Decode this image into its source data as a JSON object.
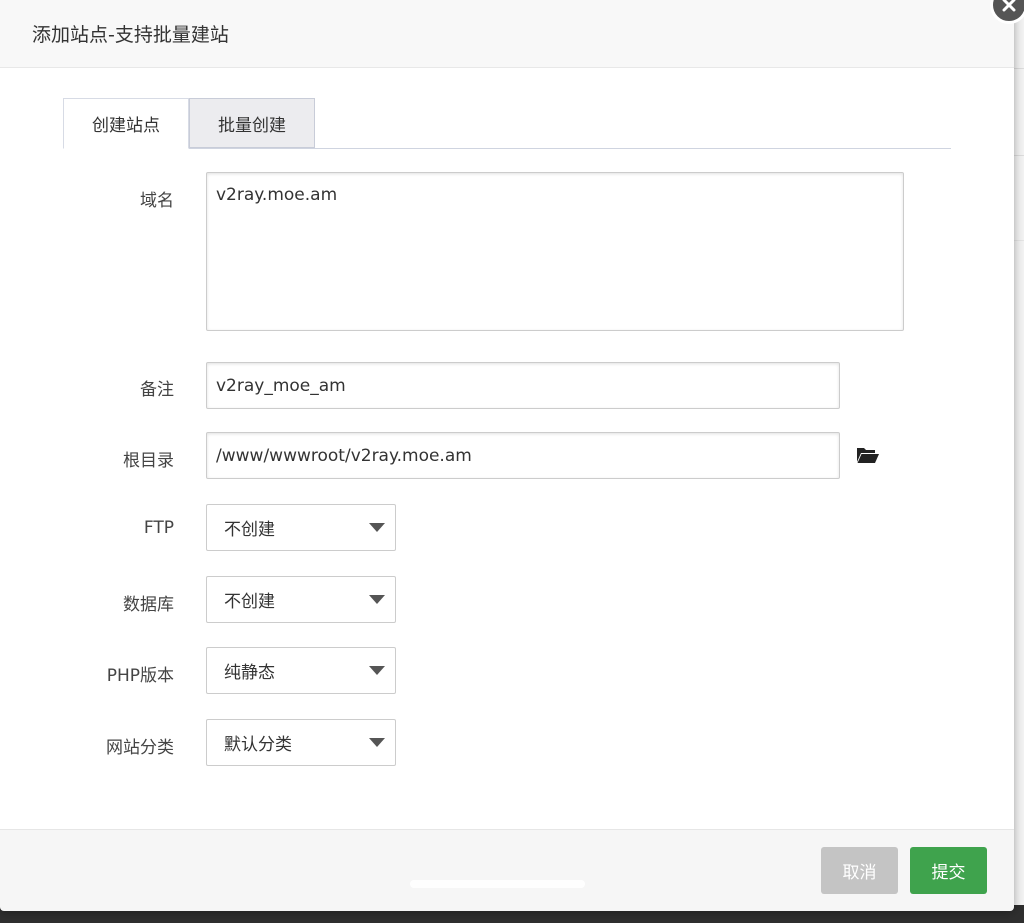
{
  "dialog": {
    "title": "添加站点-支持批量建站"
  },
  "tabs": [
    {
      "label": "创建站点",
      "active": true
    },
    {
      "label": "批量创建",
      "active": false
    }
  ],
  "form": {
    "domain": {
      "label": "域名",
      "value": "v2ray.moe.am"
    },
    "remark": {
      "label": "备注",
      "value": "v2ray_moe_am"
    },
    "root": {
      "label": "根目录",
      "value": "/www/wwwroot/v2ray.moe.am"
    },
    "ftp": {
      "label": "FTP",
      "selected": "不创建"
    },
    "database": {
      "label": "数据库",
      "selected": "不创建"
    },
    "php": {
      "label": "PHP版本",
      "selected": "纯静态"
    },
    "category": {
      "label": "网站分类",
      "selected": "默认分类"
    }
  },
  "footer": {
    "cancel_label": "取消",
    "submit_label": "提交"
  },
  "colors": {
    "submit": "#3fa34d",
    "cancel": "#c4c4c4"
  },
  "icons": {
    "close": "close-icon",
    "folder": "folder-open-icon",
    "caret": "caret-down-icon"
  }
}
